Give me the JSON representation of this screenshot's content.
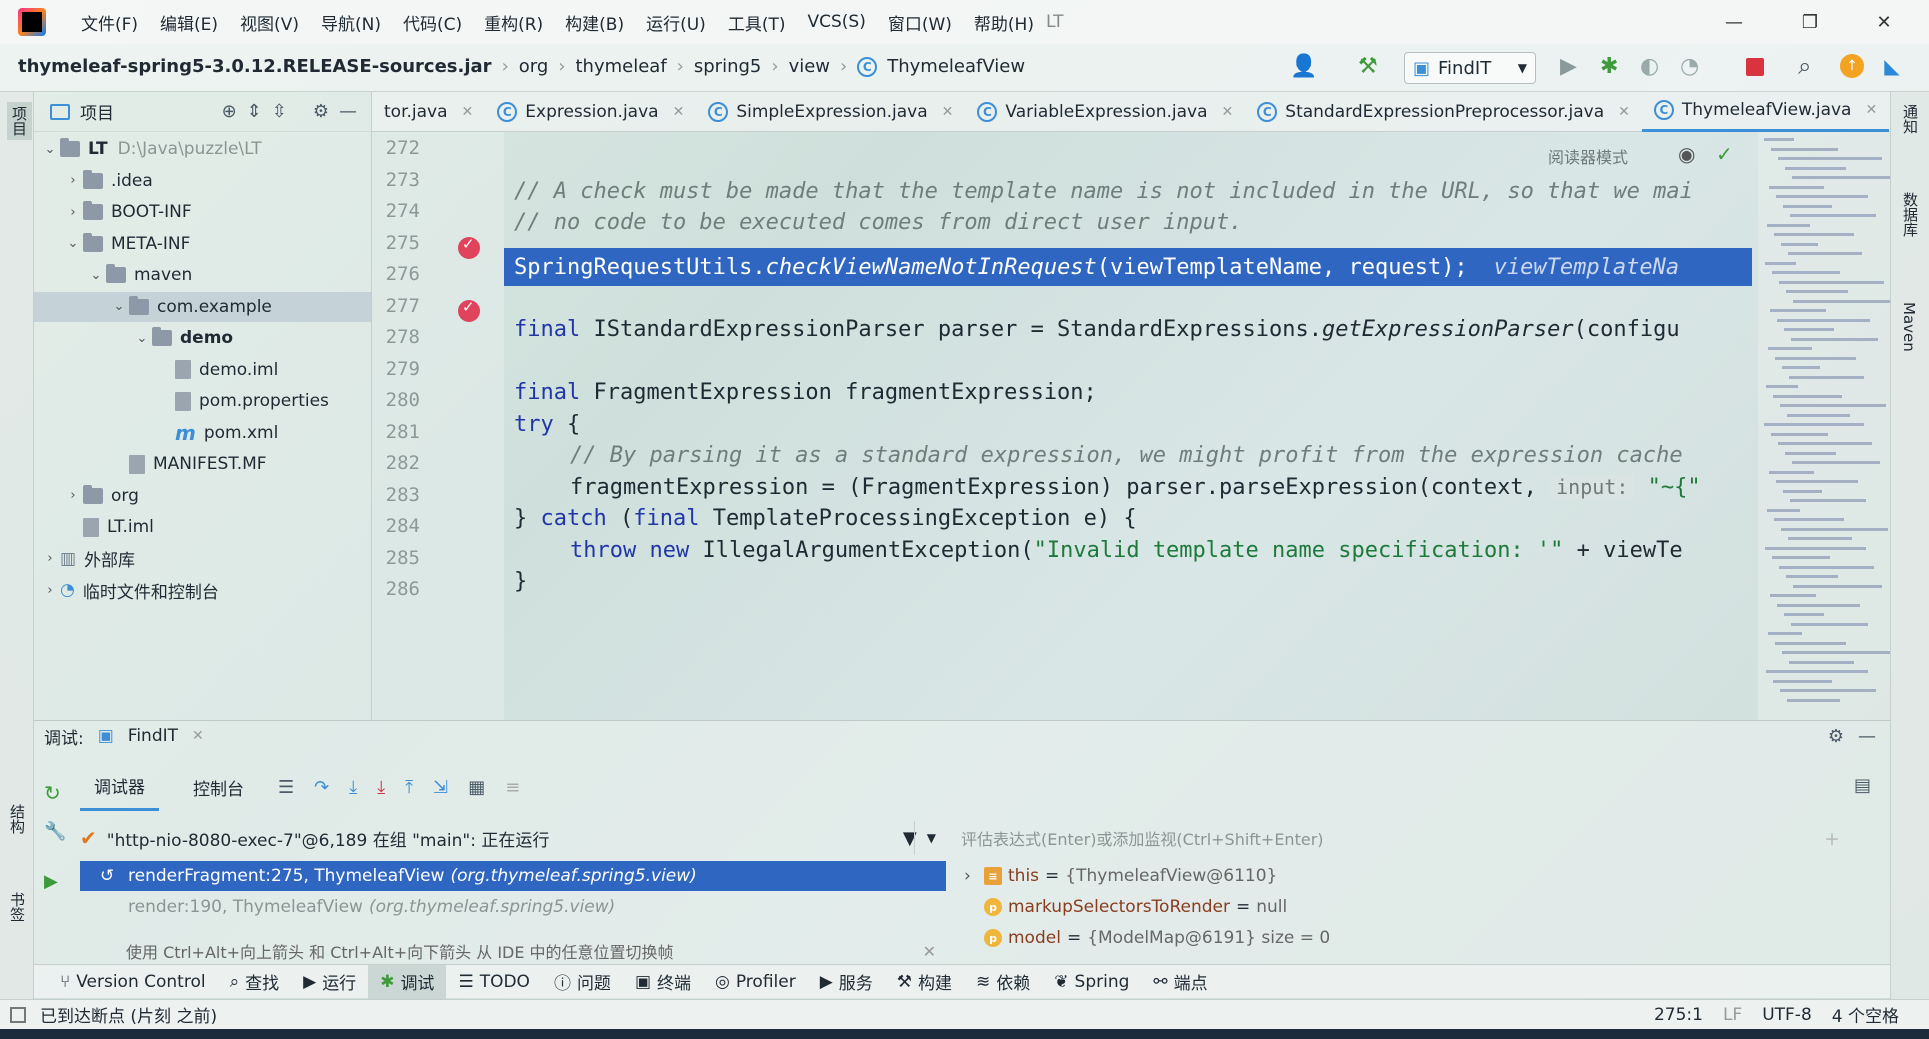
{
  "menu": [
    "文件(F)",
    "编辑(E)",
    "视图(V)",
    "导航(N)",
    "代码(C)",
    "重构(R)",
    "构建(B)",
    "运行(U)",
    "工具(T)",
    "VCS(S)",
    "窗口(W)",
    "帮助(H)"
  ],
  "window_title": "LT",
  "breadcrumb": [
    "thymeleaf-spring5-3.0.12.RELEASE-sources.jar",
    "org",
    "thymeleaf",
    "spring5",
    "view",
    "ThymeleafView"
  ],
  "run_config": "FindIT",
  "project": {
    "header": "项目",
    "tree": [
      {
        "label": "LT",
        "extra": "D:\\Java\\puzzle\\LT",
        "bold": true,
        "depth": 0,
        "arrow": "⌄",
        "kind": "folder"
      },
      {
        "label": ".idea",
        "depth": 1,
        "arrow": "›",
        "kind": "folder"
      },
      {
        "label": "BOOT-INF",
        "depth": 1,
        "arrow": "›",
        "kind": "folder"
      },
      {
        "label": "META-INF",
        "depth": 1,
        "arrow": "⌄",
        "kind": "folder"
      },
      {
        "label": "maven",
        "depth": 2,
        "arrow": "⌄",
        "kind": "folder"
      },
      {
        "label": "com.example",
        "depth": 3,
        "arrow": "⌄",
        "kind": "folder",
        "selected": true
      },
      {
        "label": "demo",
        "depth": 4,
        "arrow": "⌄",
        "kind": "folder",
        "bold": true
      },
      {
        "label": "demo.iml",
        "depth": 5,
        "arrow": "",
        "kind": "file"
      },
      {
        "label": "pom.properties",
        "depth": 5,
        "arrow": "",
        "kind": "file"
      },
      {
        "label": "pom.xml",
        "depth": 5,
        "arrow": "",
        "kind": "maven"
      },
      {
        "label": "MANIFEST.MF",
        "depth": 3,
        "arrow": "",
        "kind": "file"
      },
      {
        "label": "org",
        "depth": 1,
        "arrow": "›",
        "kind": "folder"
      },
      {
        "label": "LT.iml",
        "depth": 1,
        "arrow": "",
        "kind": "file"
      },
      {
        "label": "外部库",
        "depth": 0,
        "arrow": "›",
        "kind": "lib"
      },
      {
        "label": "临时文件和控制台",
        "depth": 0,
        "arrow": "›",
        "kind": "scratch"
      }
    ]
  },
  "tabs": [
    {
      "label": "tor.java",
      "active": false
    },
    {
      "label": "Expression.java",
      "active": false
    },
    {
      "label": "SimpleExpression.java",
      "active": false
    },
    {
      "label": "VariableExpression.java",
      "active": false
    },
    {
      "label": "StandardExpressionPreprocessor.java",
      "active": false
    },
    {
      "label": "ThymeleafView.java",
      "active": true
    }
  ],
  "reader_mode": "阅读器模式",
  "line_numbers": [
    "272",
    "273",
    "274",
    "275",
    "276",
    "277",
    "278",
    "279",
    "280",
    "281",
    "282",
    "283",
    "284",
    "285",
    "286"
  ],
  "code": {
    "l273": "// A check must be made that the template name is not included in the URL, so that we mai",
    "l274": "// no code to be executed comes from direct user input.",
    "l275a": "SpringRequestUtils.",
    "l275b": "checkViewNameNotInRequest",
    "l275c": "(viewTemplateName, request);",
    "l275hint": "viewTemplateNa",
    "l277a": "final",
    "l277b": " IStandardExpressionParser parser = StandardExpressions.",
    "l277c": "getExpressionParser",
    "l277d": "(configu",
    "l279a": "final",
    "l279b": " FragmentExpression fragmentExpression;",
    "l280a": "try",
    "l280b": " {",
    "l281": "// By parsing it as a standard expression, we might profit from the expression cache",
    "l282a": "fragmentExpression = (FragmentExpression) parser.parseExpression(context, ",
    "l282hint": "input:",
    "l282b": " \"~{\"",
    "l283a": "} ",
    "l283b": "catch",
    "l283c": " (",
    "l283d": "final",
    "l283e": " TemplateProcessingException e) {",
    "l284a": "throw",
    "l284b": " ",
    "l284c": "new",
    "l284d": " IllegalArgumentException(",
    "l284e": "\"Invalid template name specification: '\"",
    "l284f": " + viewTe",
    "l285": "}"
  },
  "debug": {
    "label": "调试:",
    "session": "FindIT",
    "tab_debugger": "调试器",
    "tab_console": "控制台",
    "thread": "\"http-nio-8080-exec-7\"@6,189 在组 \"main\": 正在运行",
    "frames": [
      {
        "method": "renderFragment:275, ThymeleafView",
        "pkg": "(org.thymeleaf.spring5.view)",
        "selected": true
      },
      {
        "method": "render:190, ThymeleafView",
        "pkg": "(org.thymeleaf.spring5.view)",
        "selected": false
      }
    ],
    "tip": "使用 Ctrl+Alt+向上箭头 和 Ctrl+Alt+向下箭头 从 IDE 中的任意位置切换帧",
    "eval_placeholder": "评估表达式(Enter)或添加监视(Ctrl+Shift+Enter)",
    "vars": [
      {
        "name": "this",
        "value": "{ThymeleafView@6110}",
        "badge": "≡"
      },
      {
        "name": "markupSelectorsToRender",
        "value": "null",
        "badge": "p"
      },
      {
        "name": "model",
        "value": "{ModelMap@6191}  size = 0",
        "badge": "p"
      }
    ]
  },
  "toolwindows": [
    {
      "label": "Version Control",
      "icon": "branch-icon",
      "glyph": "⑂"
    },
    {
      "label": "查找",
      "icon": "search-icon",
      "glyph": "⌕"
    },
    {
      "label": "运行",
      "icon": "run-icon",
      "glyph": "▶"
    },
    {
      "label": "调试",
      "icon": "bug-icon",
      "glyph": "✱",
      "active": true
    },
    {
      "label": "TODO",
      "icon": "list-icon",
      "glyph": "☰"
    },
    {
      "label": "问题",
      "icon": "problem-icon",
      "glyph": "ⓘ"
    },
    {
      "label": "终端",
      "icon": "terminal-icon",
      "glyph": "▣"
    },
    {
      "label": "Profiler",
      "icon": "profiler-icon",
      "glyph": "◎"
    },
    {
      "label": "服务",
      "icon": "services-icon",
      "glyph": "▶"
    },
    {
      "label": "构建",
      "icon": "hammer-icon",
      "glyph": "⚒"
    },
    {
      "label": "依赖",
      "icon": "layers-icon",
      "glyph": "≋"
    },
    {
      "label": "Spring",
      "icon": "spring-icon",
      "glyph": "❦"
    },
    {
      "label": "端点",
      "icon": "endpoints-icon",
      "glyph": "⚯"
    }
  ],
  "status": {
    "message": "已到达断点 (片刻 之前)",
    "position": "275:1",
    "line_sep": "LF",
    "encoding": "UTF-8",
    "indent": "4 个空格"
  },
  "left_strip": [
    "项目",
    "结构",
    "书签"
  ],
  "right_strip": [
    "通知",
    "数据库",
    "Maven"
  ]
}
